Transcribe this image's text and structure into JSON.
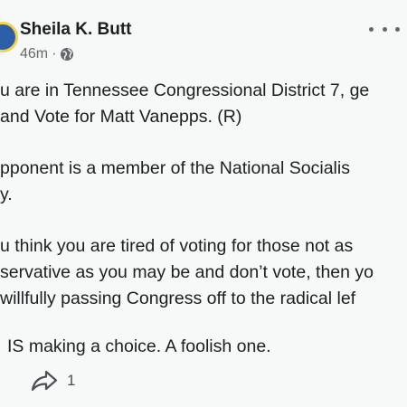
{
  "post": {
    "author": "Sheila K. Butt",
    "time": "46m",
    "separator": "·",
    "lines": [
      "u are in Tennessee Congressional District 7, ge",
      "and Vote for Matt Vanepps. (R)",
      "pponent is a member of the National Socialis",
      "y.",
      "u think you are tired of voting for those not as",
      "servative as you may be and don’t vote, then yo",
      "willfully passing Congress off to the radical lef",
      "IS making a choice. A foolish one."
    ],
    "share_count": "1"
  },
  "icons": {
    "globe": "globe-icon",
    "more": "more-dots-icon",
    "share": "share-icon"
  }
}
